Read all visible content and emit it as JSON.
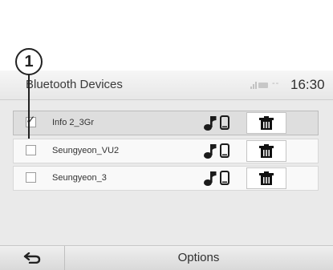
{
  "callout": {
    "number": "1"
  },
  "header": {
    "title": "Bluetooth Devices",
    "network_status": "--",
    "time": "16:30"
  },
  "devices": [
    {
      "name": "Info 2_3Gr",
      "checked": true,
      "selected": true,
      "icons": [
        "music-note-icon",
        "phone-icon"
      ]
    },
    {
      "name": "Seungyeon_VU2",
      "checked": false,
      "selected": false,
      "icons": [
        "music-note-icon",
        "phone-icon"
      ]
    },
    {
      "name": "Seungyeon_3",
      "checked": false,
      "selected": false,
      "icons": [
        "music-note-icon",
        "phone-icon"
      ]
    }
  ],
  "footer": {
    "back_icon": "back-arrow-icon",
    "options_label": "Options"
  }
}
